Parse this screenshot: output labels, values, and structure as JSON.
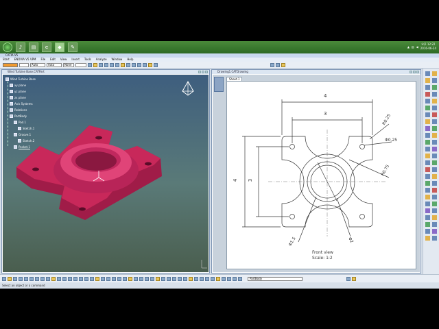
{
  "taskbar": {
    "apps": [
      {
        "icon": "start-orb-icon"
      },
      {
        "icon": "media-icon"
      },
      {
        "icon": "explorer-icon"
      },
      {
        "icon": "ie-icon"
      },
      {
        "icon": "catia-app-icon"
      },
      {
        "icon": "paint-icon"
      }
    ],
    "clock_time": "오후 12:22",
    "clock_date": "2016-06-24"
  },
  "app": {
    "title": "CATIA V5",
    "menu": [
      "Start",
      "ENOVIA V5 VPM",
      "File",
      "Edit",
      "View",
      "Insert",
      "Tools",
      "Analyze",
      "Window",
      "Help"
    ],
    "toolbar": {
      "line_type": "Auto",
      "line_weight": "Auto",
      "layer": "None"
    }
  },
  "part_window": {
    "title": "Wind Turbine Base.CATPart",
    "tree": [
      {
        "label": "Wind Turbine Base",
        "level": 0
      },
      {
        "label": "xy plane",
        "level": 1
      },
      {
        "label": "yz plane",
        "level": 1
      },
      {
        "label": "zx plane",
        "level": 1
      },
      {
        "label": "Axis Systems",
        "level": 1
      },
      {
        "label": "Relations",
        "level": 1
      },
      {
        "label": "PartBody",
        "level": 1
      },
      {
        "label": "Pad.1",
        "level": 2
      },
      {
        "label": "Sketch.1",
        "level": 3
      },
      {
        "label": "Groove.1",
        "level": 2
      },
      {
        "label": "Sketch.2",
        "level": 3
      },
      {
        "label": "Pocket.1",
        "level": 2
      }
    ],
    "part_color": "#c8285a"
  },
  "drawing_window": {
    "title": "Drawing1.CATDrawing",
    "sheet_tab": "Sheet.1",
    "dims": {
      "overall_width": "4",
      "hole_spacing": "3",
      "height_overall": "4",
      "height_spacing": "3",
      "r_corner": "R0.25",
      "hole_dia": "Φ0.25",
      "r_arc": "R0.75",
      "bore_dia": "Φ1.5",
      "pcd": "Φ2"
    },
    "view_label": "Front view",
    "view_scale": "Scale: 1:2"
  },
  "bottom": {
    "body_select": "PartBody"
  },
  "status": {
    "message": "Select an object or a command"
  }
}
